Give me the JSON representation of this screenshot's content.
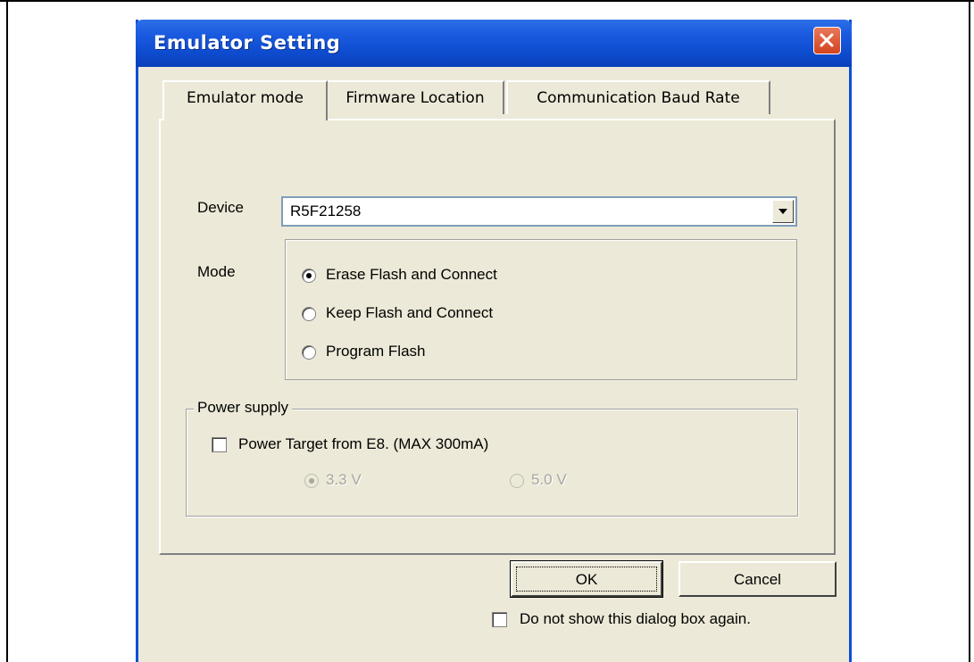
{
  "dialog": {
    "title": "Emulator Setting"
  },
  "tabs": [
    {
      "label": "Emulator mode",
      "active": true
    },
    {
      "label": "Firmware Location",
      "active": false
    },
    {
      "label": "Communication Baud Rate",
      "active": false
    }
  ],
  "device": {
    "label": "Device",
    "value": "R5F21258"
  },
  "mode": {
    "label": "Mode",
    "options": [
      {
        "label": "Erase Flash and Connect",
        "selected": true
      },
      {
        "label": "Keep Flash and Connect",
        "selected": false
      },
      {
        "label": "Program Flash",
        "selected": false
      }
    ]
  },
  "power_supply": {
    "group_label": "Power supply",
    "checkbox_label": "Power Target from E8. (MAX 300mA)",
    "checked": false,
    "voltages": [
      {
        "label": "3.3 V",
        "selected": true,
        "enabled": false
      },
      {
        "label": "5.0 V",
        "selected": false,
        "enabled": false
      }
    ]
  },
  "buttons": {
    "ok": "OK",
    "cancel": "Cancel"
  },
  "footer": {
    "dont_show_label": "Do not show this dialog box again.",
    "checked": false
  },
  "colors": {
    "titlebar": "#0b4fd8",
    "dialog_bg": "#ece9d8",
    "close_button": "#d9502b"
  },
  "icons": {
    "close": "close-icon",
    "dropdown": "chevron-down-icon"
  }
}
